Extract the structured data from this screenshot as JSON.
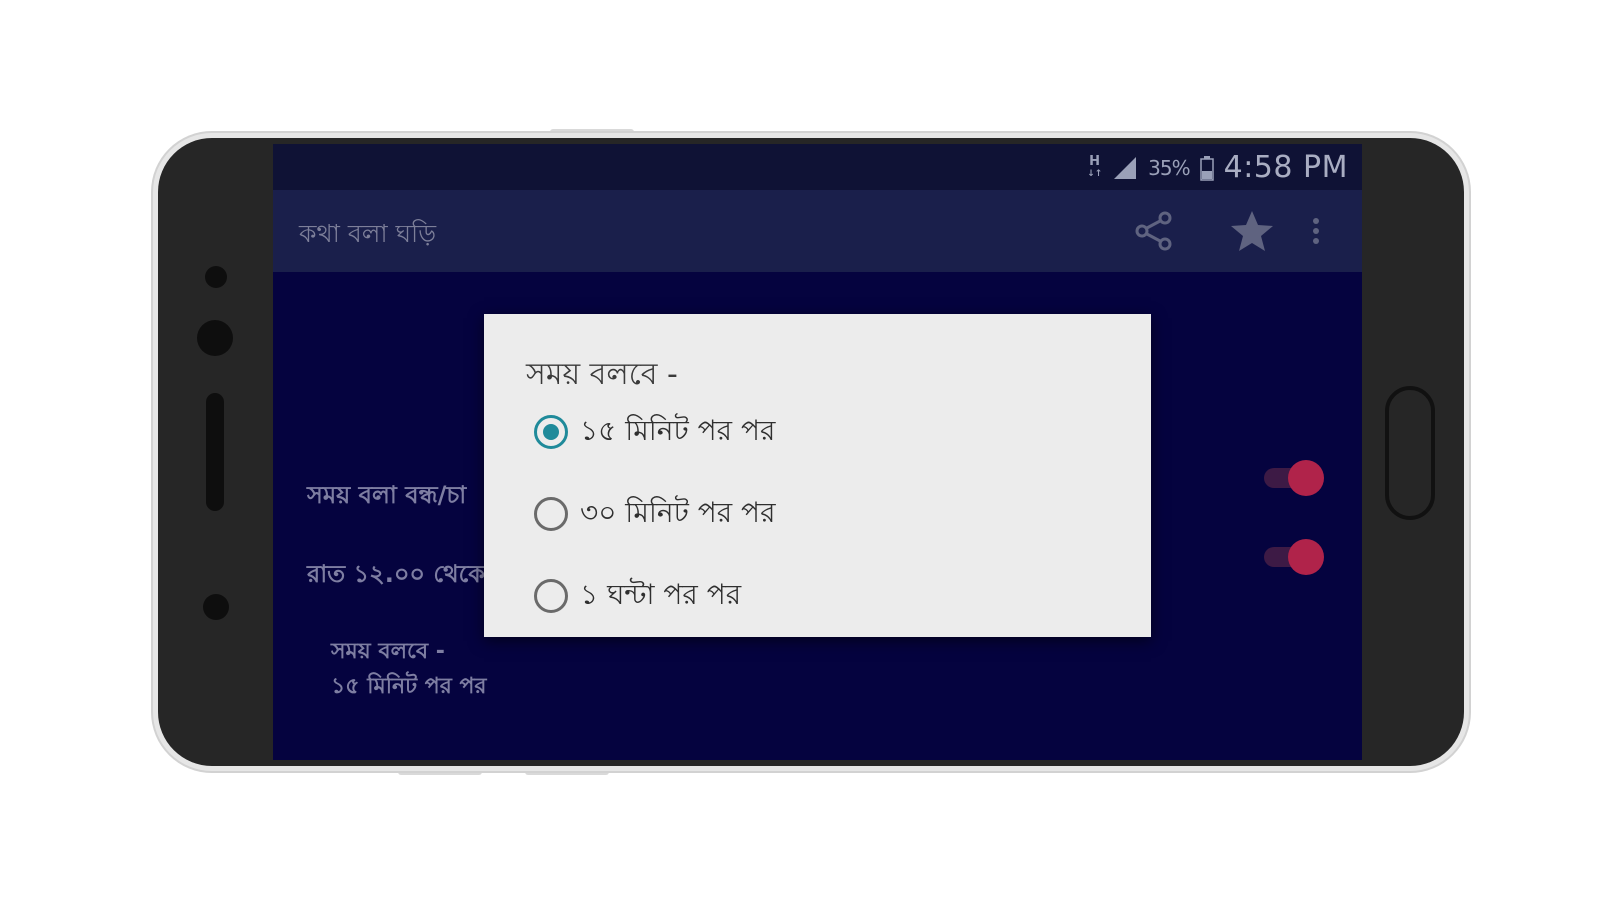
{
  "status_bar": {
    "network": "H",
    "network_sub": "↓↑",
    "battery": "35%",
    "time": "4:58 PM"
  },
  "app_bar": {
    "title": "কথা বলা ঘড়ি",
    "icons": [
      "share-icon",
      "star-icon",
      "more-vert-icon"
    ]
  },
  "settings": {
    "speaking_toggle_label": "সময় বলা বন্ধ/চা",
    "night_toggle_label": "রাত ১২.০০ থেকে",
    "speaking_on": true,
    "night_on": true,
    "interval_title": "সময় বলবে -",
    "interval_value": "১৫ মিনিট পর পর"
  },
  "dialog": {
    "title": "সময় বলবে -",
    "options": [
      {
        "label": "১৫ মিনিট পর পর",
        "selected": true
      },
      {
        "label": "৩০ মিনিট পর পর",
        "selected": false
      },
      {
        "label": "১ ঘন্টা পর পর",
        "selected": false
      }
    ]
  },
  "colors": {
    "screen_bg": "#05033f",
    "app_bar": "#1a1f4b",
    "accent_radio": "#1f8a9a",
    "toggle_thumb": "#b0234a"
  }
}
